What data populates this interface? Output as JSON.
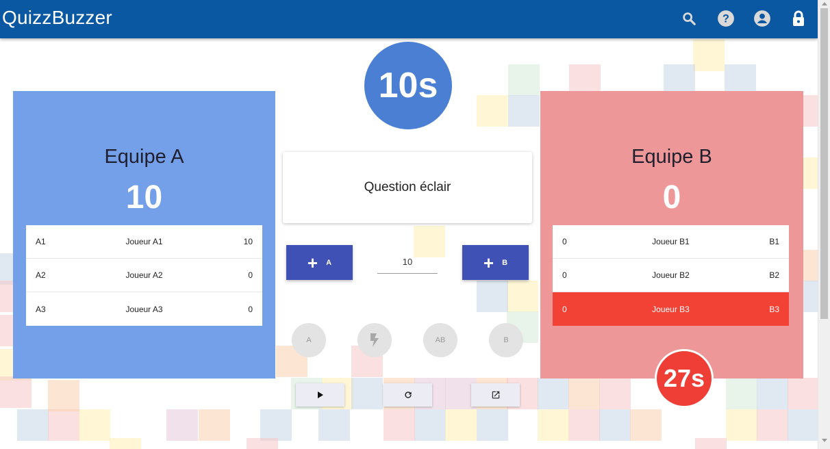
{
  "app": {
    "title": "QuizzBuzzer"
  },
  "toolbar": {
    "icons": [
      "search-icon",
      "help-icon",
      "account-icon",
      "lock-icon"
    ],
    "color": "#0a57a2"
  },
  "timers": {
    "main": "10s",
    "team_b": "27s"
  },
  "team_a": {
    "name": "Equipe A",
    "score": "10",
    "color": "#74a0ea",
    "players": [
      {
        "id": "A1",
        "name": "Joueur A1",
        "value": "10"
      },
      {
        "id": "A2",
        "name": "Joueur A2",
        "value": "0"
      },
      {
        "id": "A3",
        "name": "Joueur A3",
        "value": "0"
      }
    ]
  },
  "team_b": {
    "name": "Equipe B",
    "score": "0",
    "color": "#ee9798",
    "players": [
      {
        "value": "0",
        "name": "Joueur B1",
        "id": "B1"
      },
      {
        "value": "0",
        "name": "Joueur B2",
        "id": "B2"
      },
      {
        "value": "0",
        "name": "Joueur B3",
        "id": "B3"
      }
    ]
  },
  "question": {
    "title": "Question éclair"
  },
  "controls": {
    "add_a_label": "A",
    "add_b_label": "B",
    "points_value": "10",
    "buzzer_buttons": [
      "A",
      "",
      "AB",
      "B"
    ],
    "action_icons": [
      "play-icon",
      "refresh-icon",
      "open-external-icon"
    ],
    "accent": "#3f51b5"
  }
}
